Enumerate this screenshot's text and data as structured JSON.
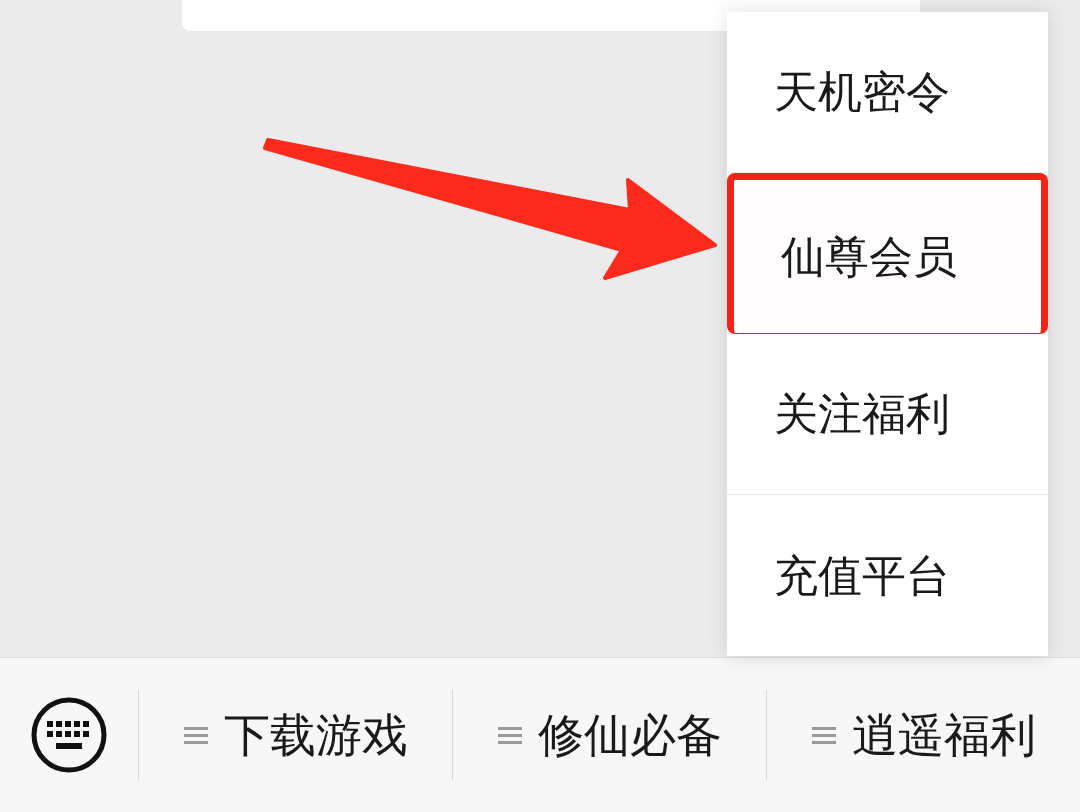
{
  "popup_menu": {
    "items": [
      {
        "label": "天机密令",
        "selected": false
      },
      {
        "label": "仙尊会员",
        "selected": true
      },
      {
        "label": "关注福利",
        "selected": false
      },
      {
        "label": "充值平台",
        "selected": false
      }
    ]
  },
  "bottom_menu": {
    "items": [
      {
        "label": "下载游戏"
      },
      {
        "label": "修仙必备"
      },
      {
        "label": "逍遥福利"
      }
    ]
  }
}
